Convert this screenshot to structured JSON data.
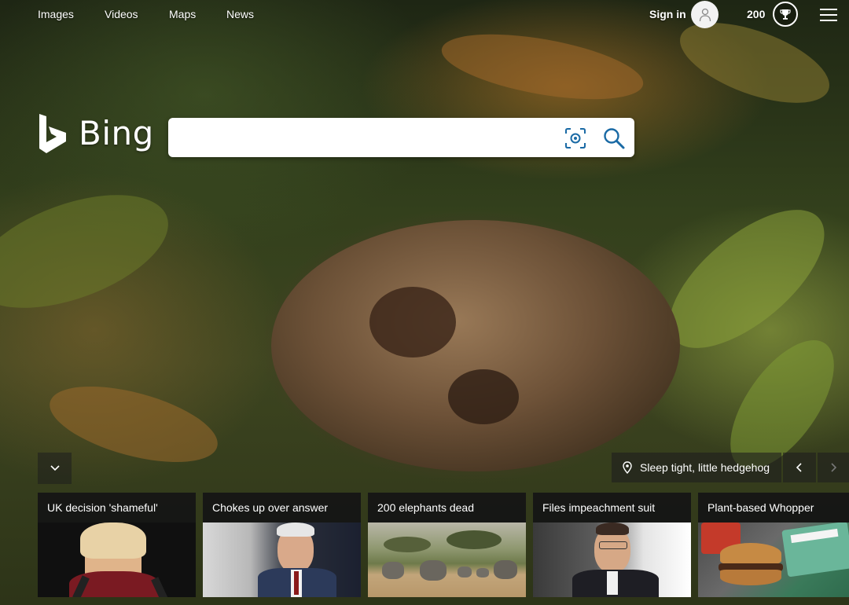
{
  "nav": {
    "links": [
      "Images",
      "Videos",
      "Maps",
      "News"
    ],
    "sign_in": "Sign in",
    "points": "200",
    "icons": {
      "avatar": "user-icon",
      "rewards": "trophy-icon",
      "menu": "hamburger-menu-icon"
    }
  },
  "logo": {
    "text": "Bing"
  },
  "search": {
    "value": "",
    "placeholder": "",
    "icons": [
      "visual-search-icon",
      "search-icon"
    ]
  },
  "image_caption": {
    "text": "Sleep tight, little hedgehog",
    "icon": "location-pin-icon"
  },
  "carousel": {
    "prev": "chevron-left-icon",
    "next": "chevron-right-icon",
    "collapse": "chevron-down-icon"
  },
  "news": [
    {
      "title": "UK decision 'shameful'"
    },
    {
      "title": "Chokes up over answer"
    },
    {
      "title": "200 elephants dead"
    },
    {
      "title": "Files impeachment suit"
    },
    {
      "title": "Plant-based Whopper"
    }
  ],
  "colors": {
    "accent": "#ffffff",
    "search_icon": "#1a6aa5",
    "card_bg": "#191919"
  }
}
